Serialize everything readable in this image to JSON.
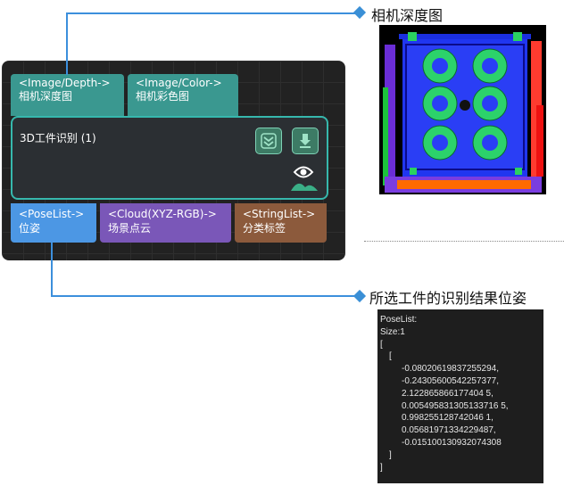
{
  "node": {
    "title": "3D工件识别 (1)",
    "inputs": [
      {
        "type": "<Image/Depth->",
        "name": "相机深度图",
        "color": "#3a9890"
      },
      {
        "type": "<Image/Color->",
        "name": "相机彩色图",
        "color": "#3a9890"
      }
    ],
    "outputs": [
      {
        "type": "<PoseList->",
        "name": "位姿",
        "color": "#4c97e4"
      },
      {
        "type": "<Cloud(XYZ-RGB)->",
        "name": "场景点云",
        "color": "#7a57b8"
      },
      {
        "type": "<StringList->",
        "name": "分类标签",
        "color": "#8c5a3c"
      }
    ],
    "icons": [
      "chevron-double-down-icon",
      "download-icon",
      "eye-visibility-icon"
    ]
  },
  "callouts": {
    "depth_label": "相机深度图",
    "pose_label": "所选工件的识别结果位姿"
  },
  "pose_output": {
    "header": "PoseList:",
    "size": "Size:1",
    "open_bracket": "[",
    "inner_open": "[",
    "values": [
      "-0.08020619837255294,",
      "-0.24305600542257377,",
      "2.122865866177404 5,",
      "0.005495831305133716 5,",
      "0.998255128742046 1,",
      "0.05681971334229487,",
      "-0.015100130932074308"
    ],
    "inner_close": "]",
    "close_bracket": "]"
  }
}
